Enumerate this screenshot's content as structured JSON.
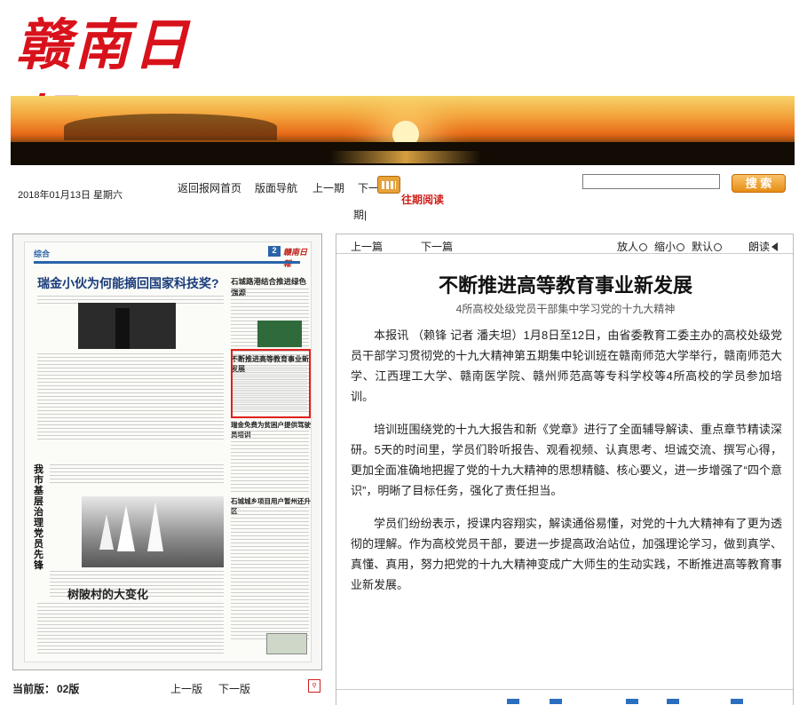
{
  "masthead": {
    "logo_text": "赣南日報"
  },
  "header": {
    "date": "2018年01月13日  星期六",
    "nav": [
      "返回报网首页",
      "版面导航",
      "上一期",
      "下一期"
    ],
    "past_label": "往期阅读",
    "period_tail": "期",
    "search_placeholder": "",
    "search_label": "搜 索"
  },
  "page_thumbnail": {
    "section": "综合",
    "page_no": "2",
    "headline_main": "瑞金小伙为何能摘回国家科技奖?",
    "headline_right1": "石城路港结合推进绿色强源",
    "headline_right2": "不断推进高等教育事业新发展",
    "headline_right3": "瑞金免费为贫困户提供驾驶员培训",
    "headline_right4": "石城城乡项目用户暂州还升区",
    "headline_left_vertical": "我市基层治理党员先锋",
    "headline_bottom": "树陂村的大变化"
  },
  "page_footer": {
    "current_label": "当前版：",
    "current_value": "02版",
    "prev_label": "上一版",
    "next_label": "下一版"
  },
  "article": {
    "toolbar": {
      "prev": "上一篇",
      "next": "下一篇",
      "zoom_in": "放人",
      "zoom_out": "缩小",
      "default": "默认",
      "read": "朗读"
    },
    "title": "不断推进高等教育事业新发展",
    "subtitle": "4所高校处级党员干部集中学习党的十九大精神",
    "paragraphs": [
      "本报讯 （赖锋 记者 潘夫坦）1月8日至12日，由省委教育工委主办的高校处级党员干部学习贯彻党的十九大精神第五期集中轮训班在赣南师范大学举行，赣南师范大学、江西理工大学、赣南医学院、赣州师范高等专科学校等4所高校的学员参加培训。",
      "培训班围绕党的十九大报告和新《党章》进行了全面辅导解读、重点章节精读深研。5天的时间里，学员们聆听报告、观看视频、认真思考、坦诚交流、撰写心得，更加全面准确地把握了党的十九大精神的思想精髓、核心要义，进一步增强了“四个意识”，明晰了目标任务，强化了责任担当。",
      "学员们纷纷表示，授课内容翔实，解读通俗易懂，对党的十九大精神有了更为透彻的理解。作为高校党员干部，要进一步提高政治站位，加强理论学习，做到真学、真懂、真用，努力把党的十九大精神变成广大师生的生动实践，不断推进高等教育事业新发展。"
    ]
  }
}
